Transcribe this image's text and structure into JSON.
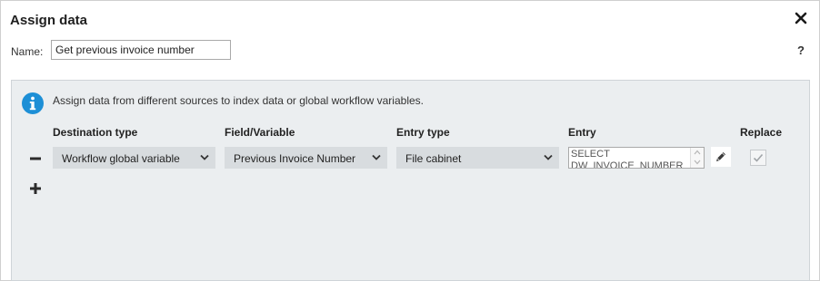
{
  "dialog": {
    "title": "Assign data",
    "close_icon": "close-icon",
    "help_label": "?"
  },
  "name": {
    "label": "Name:",
    "value": "Get previous invoice number"
  },
  "panel": {
    "info_icon": "info-icon",
    "info_text": "Assign data from different sources to index data or global workflow variables.",
    "headers": {
      "destination_type": "Destination type",
      "field_variable": "Field/Variable",
      "entry_type": "Entry type",
      "entry": "Entry",
      "replace": "Replace"
    },
    "rows": [
      {
        "destination_type": "Workflow global variable",
        "field_variable": "Previous Invoice Number",
        "entry_type": "File cabinet",
        "entry": "SELECT\nDW_INVOICE_NUMBER",
        "replace_checked": true
      }
    ],
    "remove_row_icon": "minus-icon",
    "add_row_icon": "plus-icon",
    "edit_icon": "pencil-icon"
  },
  "colors": {
    "accent": "#1d8fd6",
    "panel_bg": "#ebeef0",
    "select_bg": "#d8dcdf"
  }
}
